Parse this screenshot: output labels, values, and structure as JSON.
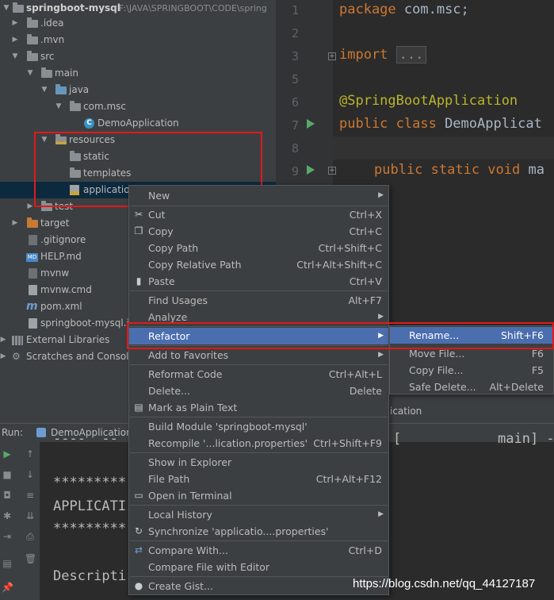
{
  "project": {
    "name": "springboot-mysql",
    "path": "F:\\JAVA\\SPRINGBOOT\\CODE\\spring",
    "tree": [
      {
        "label": "springboot-mysql",
        "icon": "folder-icon"
      },
      {
        "label": ".idea",
        "icon": "folder-icon"
      },
      {
        "label": ".mvn",
        "icon": "folder-icon"
      },
      {
        "label": "src",
        "icon": "folder-icon"
      },
      {
        "label": "main",
        "icon": "folder-icon"
      },
      {
        "label": "java",
        "icon": "source-folder-icon"
      },
      {
        "label": "com.msc",
        "icon": "package-icon"
      },
      {
        "label": "DemoApplication",
        "icon": "spring-class-icon"
      },
      {
        "label": "resources",
        "icon": "resources-folder-icon"
      },
      {
        "label": "static",
        "icon": "folder-icon"
      },
      {
        "label": "templates",
        "icon": "folder-icon"
      },
      {
        "label": "applicatio",
        "icon": "properties-file-icon"
      },
      {
        "label": "test",
        "icon": "folder-icon"
      },
      {
        "label": "target",
        "icon": "excluded-folder-icon"
      },
      {
        "label": ".gitignore",
        "icon": "file-icon"
      },
      {
        "label": "HELP.md",
        "icon": "markdown-file-icon"
      },
      {
        "label": "mvnw",
        "icon": "file-icon"
      },
      {
        "label": "mvnw.cmd",
        "icon": "file-icon"
      },
      {
        "label": "pom.xml",
        "icon": "maven-icon"
      },
      {
        "label": "springboot-mysql.i",
        "icon": "file-icon"
      },
      {
        "label": "External Libraries",
        "icon": "library-icon"
      },
      {
        "label": "Scratches and Console",
        "icon": "scratches-icon"
      }
    ]
  },
  "editor": {
    "line_numbers": [
      "1",
      "2",
      "3",
      "5",
      "6",
      "7",
      "8",
      "9"
    ],
    "lines": {
      "l1_kw": "package",
      "l1_rest": " com.msc;",
      "l3_kw": "import",
      "l3_fold": "...",
      "l6_ann": "@SpringBootApplication",
      "l7_kw": "public class",
      "l7_rest": " DemoApplicat",
      "l9_kw": "public static void",
      "l9_rest": " ma"
    }
  },
  "run_panel": {
    "label": "Run:",
    "tab": "DemoApplication",
    "behind_text": "ication",
    "console_lines": [
      "*********",
      "APPLICATI",
      "*********",
      "Descripti"
    ],
    "console_fragments": {
      "left": "----  --  --",
      "mid": "[",
      "right": "main] -"
    }
  },
  "context_menu": {
    "items": [
      {
        "label": "New",
        "shortcut": "",
        "submenu": true
      },
      {
        "label": "Cut",
        "shortcut": "Ctrl+X",
        "icon": "scissors-icon"
      },
      {
        "label": "Copy",
        "shortcut": "Ctrl+C",
        "icon": "copy-icon"
      },
      {
        "label": "Copy Path",
        "shortcut": "Ctrl+Shift+C"
      },
      {
        "label": "Copy Relative Path",
        "shortcut": "Ctrl+Alt+Shift+C"
      },
      {
        "label": "Paste",
        "shortcut": "Ctrl+V",
        "icon": "paste-icon"
      },
      {
        "label": "Find Usages",
        "shortcut": "Alt+F7"
      },
      {
        "label": "Analyze",
        "shortcut": "",
        "submenu": true
      },
      {
        "label": "Refactor",
        "shortcut": "",
        "submenu": true,
        "active": true
      },
      {
        "label": "Add to Favorites",
        "shortcut": "",
        "submenu": true
      },
      {
        "label": "Reformat Code",
        "shortcut": "Ctrl+Alt+L"
      },
      {
        "label": "Delete...",
        "shortcut": "Delete"
      },
      {
        "label": "Mark as Plain Text",
        "shortcut": "",
        "icon": "text-file-icon"
      },
      {
        "label": "Build Module 'springboot-mysql'",
        "shortcut": ""
      },
      {
        "label": "Recompile '...lication.properties'",
        "shortcut": "Ctrl+Shift+F9"
      },
      {
        "label": "Show in Explorer",
        "shortcut": ""
      },
      {
        "label": "File Path",
        "shortcut": "Ctrl+Alt+F12"
      },
      {
        "label": "Open in Terminal",
        "shortcut": "",
        "icon": "terminal-icon"
      },
      {
        "label": "Local History",
        "shortcut": "",
        "submenu": true
      },
      {
        "label": "Synchronize 'applicatio....properties'",
        "shortcut": "",
        "icon": "sync-icon"
      },
      {
        "label": "Compare With...",
        "shortcut": "Ctrl+D",
        "icon": "compare-icon"
      },
      {
        "label": "Compare File with Editor",
        "shortcut": ""
      },
      {
        "label": "Create Gist...",
        "shortcut": "",
        "icon": "github-icon"
      }
    ]
  },
  "refactor_submenu": {
    "items": [
      {
        "label": "Rename...",
        "shortcut": "Shift+F6",
        "active": true
      },
      {
        "label": "Move File...",
        "shortcut": "F6"
      },
      {
        "label": "Copy File...",
        "shortcut": "F5"
      },
      {
        "label": "Safe Delete...",
        "shortcut": "Alt+Delete"
      }
    ]
  },
  "watermark": "https://blog.csdn.net/qq_44127187",
  "colors": {
    "menu_bg": "#3c3f41",
    "selection": "#4b6eaf",
    "highlight_box": "#e0191b",
    "keyword": "#cc7832",
    "annotation": "#bbb529"
  }
}
